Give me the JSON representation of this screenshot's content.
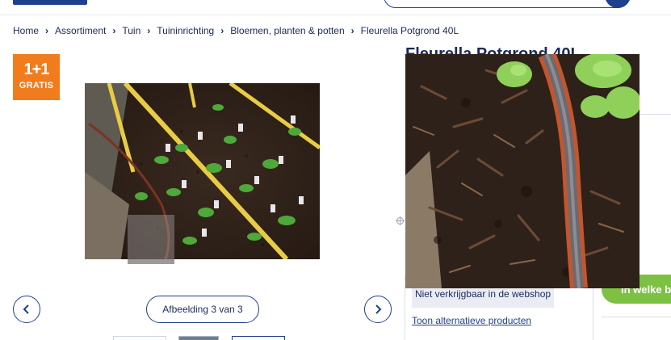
{
  "breadcrumb": {
    "items": [
      "Home",
      "Assortiment",
      "Tuin",
      "Tuininrichting",
      "Bloemen, planten & potten",
      "Fleurella Potgrond 40L"
    ]
  },
  "promo_badge": {
    "top": "1+1",
    "bottom": "GRATIS",
    "color": "#f07c1e"
  },
  "product": {
    "title": "Fleurella Potgrond 40L"
  },
  "gallery": {
    "counter": "Afbeelding 3 van 3",
    "prev_icon": "chevron-left-icon",
    "next_icon": "chevron-right-icon",
    "zoom_cursor_icon": "crosshair-icon"
  },
  "availability": {
    "status": "Niet verkrijgbaar in de webshop",
    "alternative_link": "Toon alternatieve producten"
  },
  "store_button": {
    "label": "In welke b",
    "color": "#7cc142"
  },
  "colors": {
    "brand_navy": "#1f3f8f",
    "text": "#1a2a5a"
  }
}
